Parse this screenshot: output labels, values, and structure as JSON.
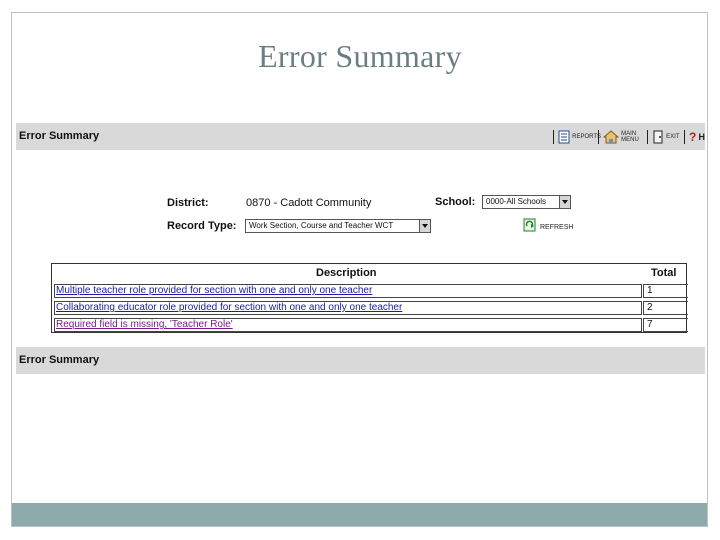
{
  "slide": {
    "title": "Error Summary"
  },
  "header": {
    "title": "Error Summary",
    "tools": {
      "reports": "Reports",
      "main_menu": "Main Menu",
      "exit": "Exit",
      "help": "H"
    }
  },
  "filters": {
    "district_label": "District:",
    "district_value": "0870 - Cadott Community",
    "school_label": "School:",
    "school_value": "0000-All Schools",
    "record_type_label": "Record Type:",
    "record_type_value": "Work Section, Course and Teacher WCT",
    "refresh_label": "Refresh"
  },
  "table": {
    "headers": {
      "description": "Description",
      "total": "Total"
    },
    "rows": [
      {
        "description": "Multiple teacher role provided for section with one and only one teacher",
        "total": "1"
      },
      {
        "description": "Collaborating educator role provided for section with one and only one teacher",
        "total": "2"
      },
      {
        "description": "Required field is missing, 'Teacher Role'",
        "total": "7"
      }
    ]
  },
  "footer": {
    "title": "Error Summary"
  },
  "colors": {
    "title_text": "#6b7f82",
    "bar_bg": "#d9d9d9",
    "footer_bar": "#8faaab",
    "link": "#1a1ab0",
    "visited_link": "#7a1a8c"
  }
}
